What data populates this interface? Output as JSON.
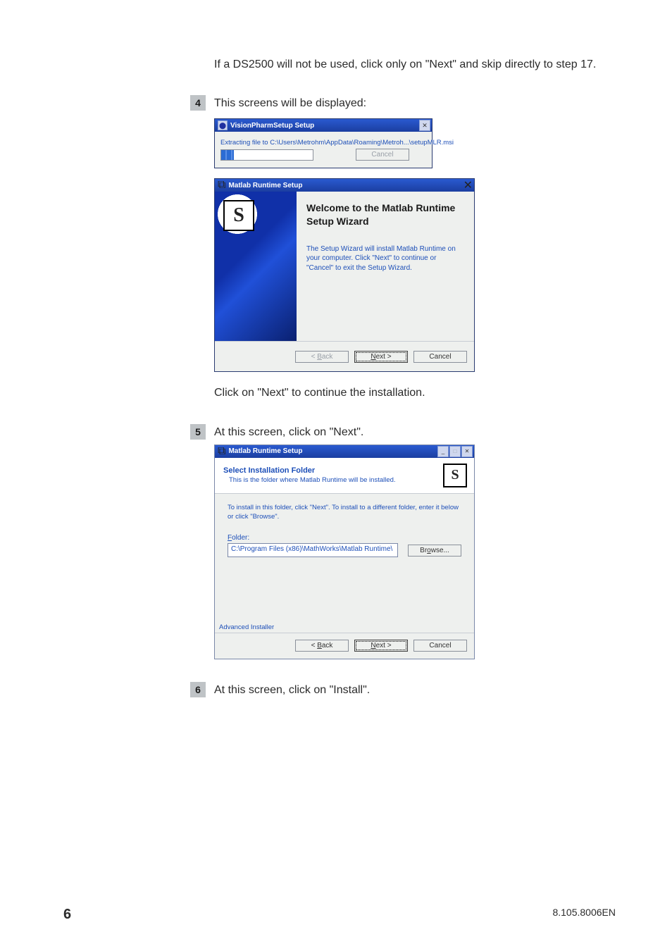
{
  "intro": "If a DS2500 will not be used, click only on \"Next\" and skip directly to step 17.",
  "steps": {
    "s4": {
      "num": "4",
      "text": "This screens will be displayed:"
    },
    "s4_after": "Click on \"Next\" to continue the installation.",
    "s5": {
      "num": "5",
      "text": "At this screen, click on \"Next\"."
    },
    "s6": {
      "num": "6",
      "text": "At this screen, click on \"Install\"."
    }
  },
  "visionpharm": {
    "title": "VisionPharmSetup Setup",
    "extracting": "Extracting file to C:\\Users\\Metrohm\\AppData\\Roaming\\Metroh...\\setupMLR.msi",
    "cancel": "Cancel"
  },
  "matlab_wizard": {
    "title": "Matlab Runtime Setup",
    "heading": "Welcome to the Matlab Runtime Setup Wizard",
    "desc": "The Setup Wizard will install Matlab Runtime on your computer. Click \"Next\" to continue or \"Cancel\" to exit the Setup Wizard.",
    "back": "< Back",
    "next": "Next >",
    "cancel": "Cancel"
  },
  "sif": {
    "title": "Matlab Runtime Setup",
    "header_title": "Select Installation Folder",
    "header_sub": "This is the folder where Matlab Runtime will be installed.",
    "msg": "To install in this folder, click \"Next\". To install to a different folder, enter it below or click \"Browse\".",
    "folder_label": "Folder:",
    "folder_value": "C:\\Program Files (x86)\\MathWorks\\Matlab Runtime\\",
    "browse": "Browse...",
    "adv": "Advanced Installer",
    "back": "< Back",
    "next": "Next >",
    "cancel": "Cancel"
  },
  "footer": {
    "page": "6",
    "docid": "8.105.8006EN"
  },
  "glyphs": {
    "close": "✕",
    "min": "_",
    "max": "□",
    "msi": "⧉",
    "s": "S"
  }
}
